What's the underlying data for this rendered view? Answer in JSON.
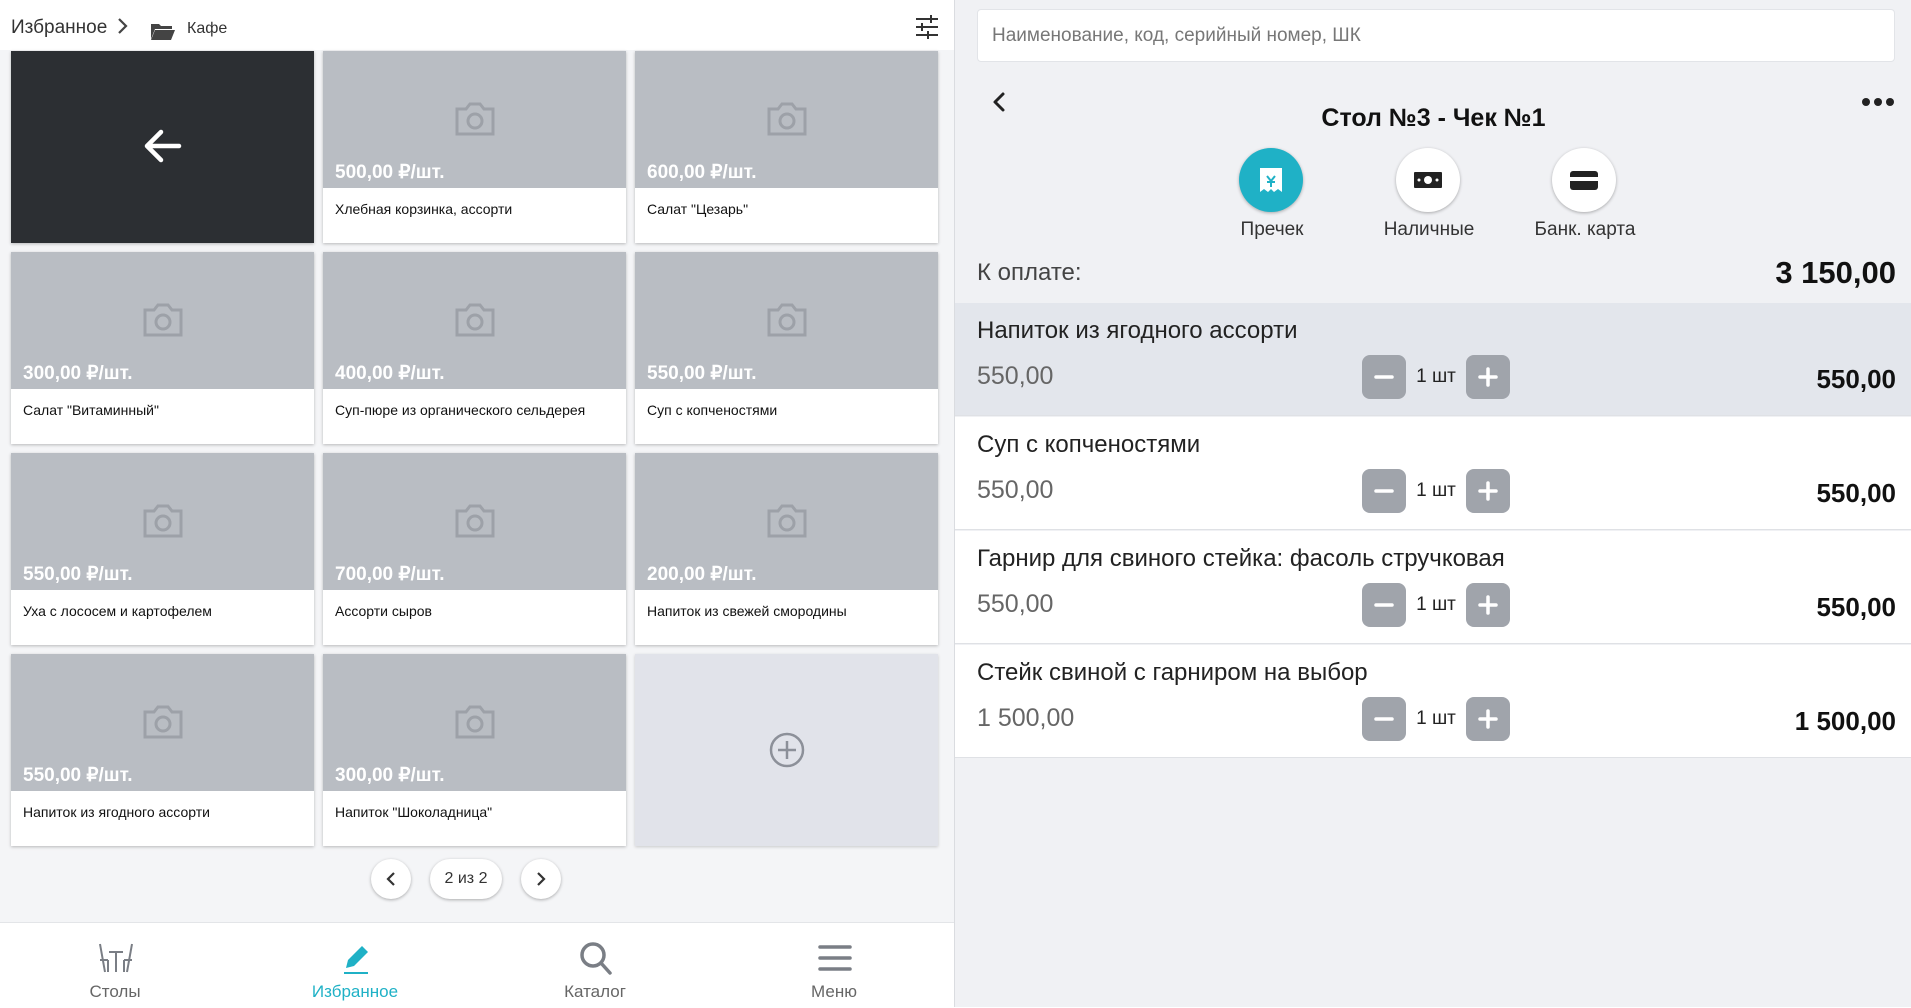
{
  "breadcrumb": {
    "root": "Избранное",
    "current": "Кафе"
  },
  "colors": {
    "accent": "#1fb1c6",
    "tile_image": "#b9bdc3",
    "back_tile": "#2c2f33",
    "add_tile": "#e1e3ea"
  },
  "tiles": [
    {
      "price": "500,00 ₽/шт.",
      "name": "Хлебная корзинка, ассорти"
    },
    {
      "price": "600,00 ₽/шт.",
      "name": "Салат \"Цезарь\""
    },
    {
      "price": "300,00 ₽/шт.",
      "name": "Салат \"Витаминный\""
    },
    {
      "price": "400,00 ₽/шт.",
      "name": "Суп-пюре из органического сельдерея"
    },
    {
      "price": "550,00 ₽/шт.",
      "name": "Суп с копченостями"
    },
    {
      "price": "550,00 ₽/шт.",
      "name": "Уха с лососем и картофелем"
    },
    {
      "price": "700,00 ₽/шт.",
      "name": "Ассорти сыров"
    },
    {
      "price": "200,00 ₽/шт.",
      "name": "Напиток из свежей смородины"
    },
    {
      "price": "550,00 ₽/шт.",
      "name": "Напиток из ягодного ассорти"
    },
    {
      "price": "300,00 ₽/шт.",
      "name": "Напиток \"Шоколадница\""
    }
  ],
  "pagination": {
    "label": "2 из 2"
  },
  "nav": [
    {
      "label": "Столы",
      "icon": "tables-icon",
      "active": false
    },
    {
      "label": "Избранное",
      "icon": "pencil-icon",
      "active": true
    },
    {
      "label": "Каталог",
      "icon": "search-icon",
      "active": false
    },
    {
      "label": "Меню",
      "icon": "menu-icon",
      "active": false
    }
  ],
  "search": {
    "placeholder": "Наименование, код, серийный номер, ШК",
    "value": ""
  },
  "order": {
    "title": "Стол №3 - Чек №1",
    "payment": [
      {
        "label": "Пречек",
        "icon": "receipt-icon",
        "active": true
      },
      {
        "label": "Наличные",
        "icon": "cash-icon",
        "active": false
      },
      {
        "label": "Банк. карта",
        "icon": "card-icon",
        "active": false
      }
    ],
    "due_label": "К оплате:",
    "due_value": "3 150,00",
    "lines": [
      {
        "name": "Напиток из ягодного ассорти",
        "price": "550,00",
        "qty": "1 шт",
        "total": "550,00",
        "selected": true
      },
      {
        "name": "Суп с копченостями",
        "price": "550,00",
        "qty": "1 шт",
        "total": "550,00",
        "selected": false
      },
      {
        "name": "Гарнир для свиного стейка: фасоль стручковая",
        "price": "550,00",
        "qty": "1 шт",
        "total": "550,00",
        "selected": false
      },
      {
        "name": "Стейк свиной с гарниром на выбор",
        "price": "1 500,00",
        "qty": "1 шт",
        "total": "1 500,00",
        "selected": false
      }
    ]
  }
}
